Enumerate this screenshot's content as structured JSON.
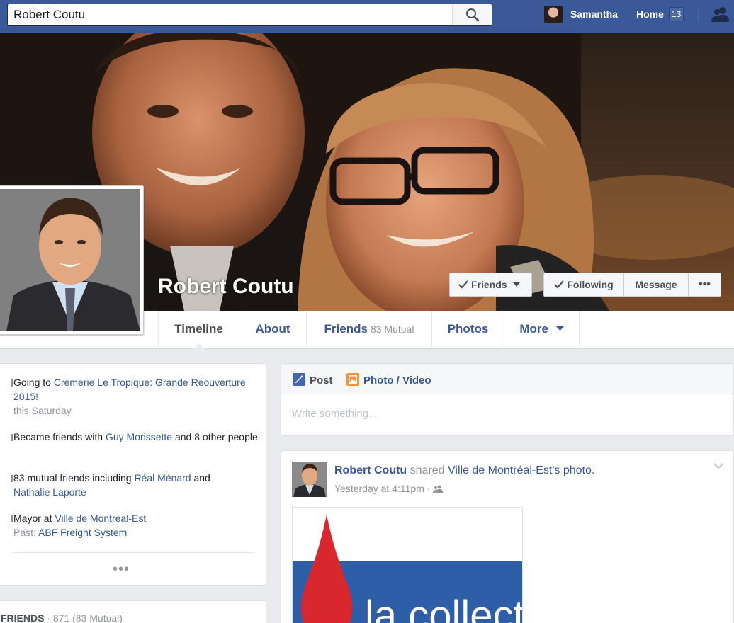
{
  "topbar": {
    "search_value": "Robert Coutu",
    "user_name": "Samantha",
    "home_label": "Home",
    "home_count": "13"
  },
  "profile": {
    "name": "Robert Coutu",
    "friends_button": "Friends",
    "following_button": "Following",
    "message_button": "Message",
    "more_button": "•••"
  },
  "nav": {
    "tabs": [
      {
        "label": "Timeline"
      },
      {
        "label": "About"
      },
      {
        "label": "Friends",
        "sub": "83 Mutual"
      },
      {
        "label": "Photos"
      },
      {
        "label": "More"
      }
    ]
  },
  "intro": {
    "event": {
      "prefix": "Going to ",
      "link": "Crémerie Le Tropique: Grande Réouverture 2015!",
      "time": "this Saturday"
    },
    "friends": {
      "prefix": "Became friends with ",
      "link": "Guy Morissette",
      "suffix": " and 8 other people"
    },
    "mutual": {
      "prefix": "83 mutual friends including ",
      "link1": "Réal Ménard",
      "mid": " and ",
      "link2": "Nathalie Laporte"
    },
    "work": {
      "prefix": "Mayor at ",
      "link": "Ville de Montréal-Est",
      "past_label": "Past: ",
      "past_link": "ABF Freight System"
    },
    "more": "•••"
  },
  "friends_card": {
    "title": "Friends",
    "count": " · 871 (83 Mutual)"
  },
  "composer": {
    "post_tab": "Post",
    "photo_tab": "Photo / Video",
    "placeholder": "Write something..."
  },
  "post": {
    "author": "Robert Coutu",
    "action": " shared ",
    "page": "Ville de Montréal-Est",
    "possessive": "'s photo.",
    "time": "Yesterday at 4:11pm",
    "time_sep": " · ",
    "image_text": "la collecte"
  },
  "colors": {
    "brand": "#3b5998",
    "link": "#365899",
    "muted": "#90949c"
  }
}
